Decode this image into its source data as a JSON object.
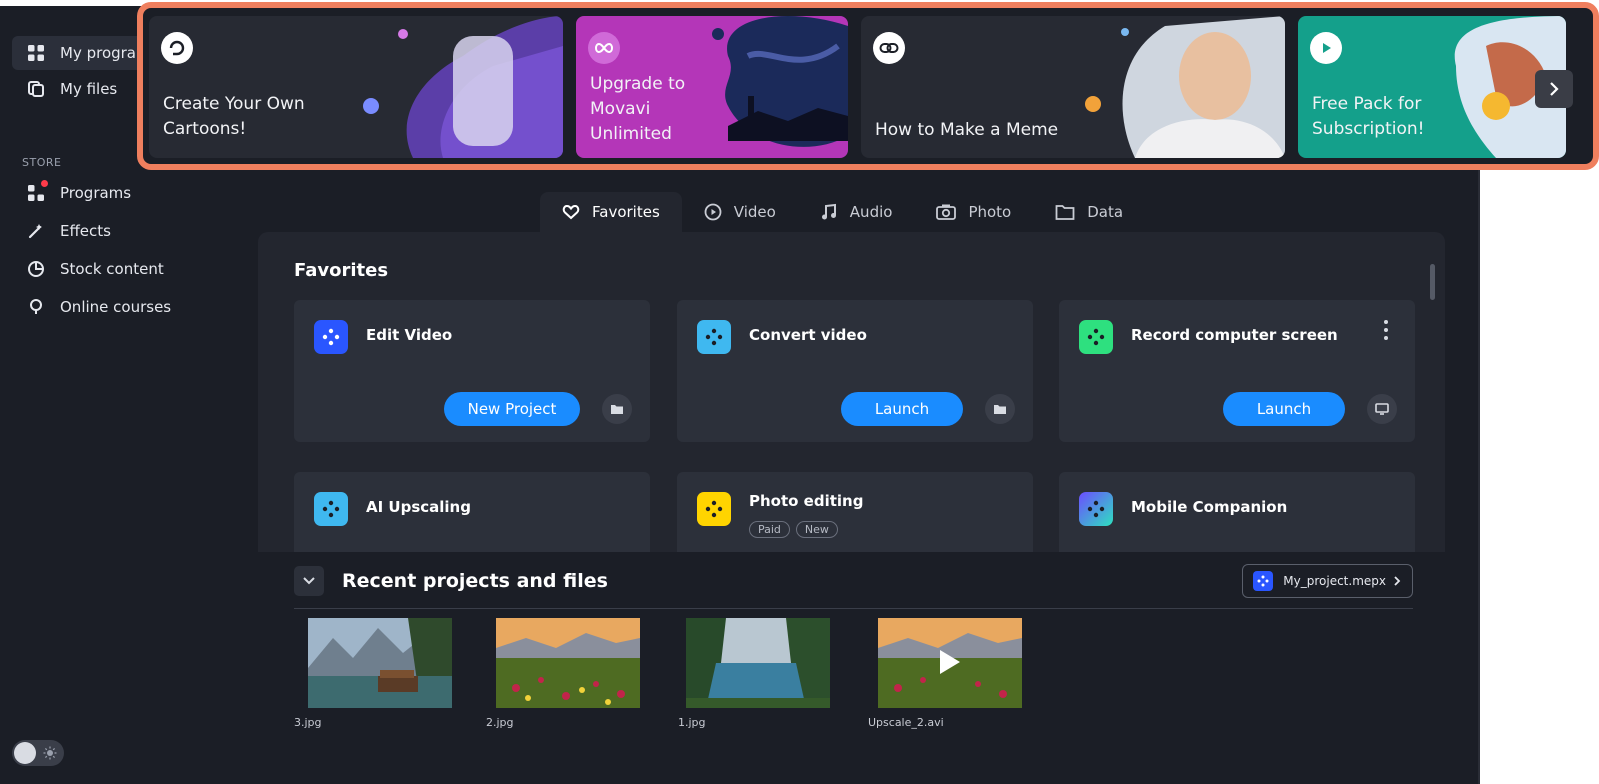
{
  "sidebar": {
    "my_programs": "My programs",
    "my_files": "My files",
    "store_label": "STORE",
    "programs": "Programs",
    "effects": "Effects",
    "stock_content": "Stock content",
    "online_courses": "Online courses"
  },
  "banners": [
    {
      "title": "Create Your Own\nCartoons!",
      "icon": "loop-arrow-icon"
    },
    {
      "title": "Upgrade to\nMovavi\nUnlimited",
      "icon": "infinity-icon"
    },
    {
      "title": "How to Make a Meme",
      "icon": "link-icon"
    },
    {
      "title": "Free Pack for\nSubscription!",
      "icon": "play-icon"
    }
  ],
  "tabs": [
    {
      "label": "Favorites",
      "icon": "heart-icon",
      "active": true
    },
    {
      "label": "Video",
      "icon": "play-circle-icon"
    },
    {
      "label": "Audio",
      "icon": "music-note-icon"
    },
    {
      "label": "Photo",
      "icon": "camera-icon"
    },
    {
      "label": "Data",
      "icon": "folder-icon"
    }
  ],
  "favorites": {
    "title": "Favorites",
    "cards": [
      {
        "title": "Edit Video",
        "button": "New Project",
        "color": "#2a56ff"
      },
      {
        "title": "Convert video",
        "button": "Launch",
        "color": "#3fb8f0"
      },
      {
        "title": "Record computer screen",
        "button": "Launch",
        "color": "#2ee07f"
      },
      {
        "title": "AI Upscaling",
        "color": "#3fb8f0"
      },
      {
        "title": "Photo editing",
        "tags": [
          "Paid",
          "New"
        ],
        "color": "#ffd400"
      },
      {
        "title": "Mobile Companion",
        "color": "#6c4dff"
      }
    ]
  },
  "recent": {
    "title": "Recent projects and files",
    "project_button": "My_project.mepx",
    "files": [
      "3.jpg",
      "2.jpg",
      "1.jpg",
      "Upscale_2.avi"
    ]
  },
  "colors": {
    "accent": "#1a8cff",
    "highlight_frame": "#ef7f5e",
    "background": "#1b1e26",
    "panel": "#23262f",
    "card": "#2c303a"
  }
}
